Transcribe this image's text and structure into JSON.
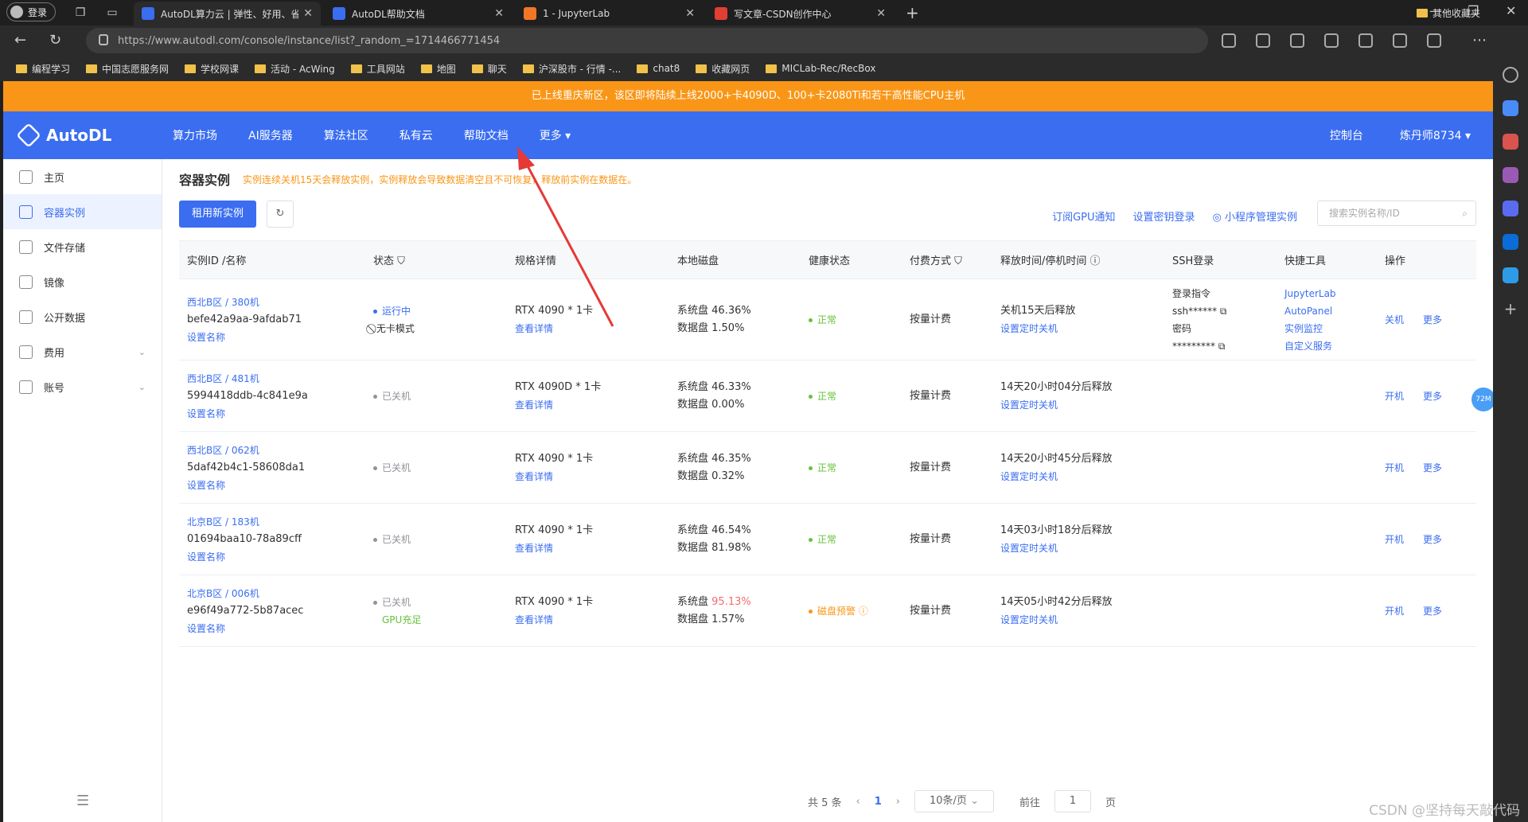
{
  "browser": {
    "profile_label": "登录",
    "tabs": [
      {
        "title": "AutoDL算力云 | 弹性、好用、省",
        "fav_color": "#3a6df0",
        "active": true
      },
      {
        "title": "AutoDL帮助文档",
        "fav_color": "#3a6df0",
        "active": false
      },
      {
        "title": "1 - JupyterLab",
        "fav_color": "#f37626",
        "active": false
      },
      {
        "title": "写文章-CSDN创作中心",
        "fav_color": "#e33e33",
        "active": false
      }
    ],
    "url": "https://www.autodl.com/console/instance/list?_random_=1714466771454",
    "bookmarks": [
      "编程学习",
      "中国志愿服务网",
      "学校网课",
      "活动 - AcWing",
      "工具网站",
      "地图",
      "聊天",
      "沪深股市 - 行情 -...",
      "chat8",
      "收藏网页",
      "MICLab-Rec/RecBox"
    ],
    "other_bookmarks": "其他收藏夹"
  },
  "banner": "已上线重庆新区，该区即将陆续上线2000+卡4090D、100+卡2080Ti和若干高性能CPU主机",
  "nav": {
    "logo": "AutoDL",
    "items": [
      "算力市场",
      "AI服务器",
      "算法社区",
      "私有云",
      "帮助文档",
      "更多 ▾"
    ],
    "console": "控制台",
    "user": "炼丹师8734 ▾"
  },
  "sidebar": {
    "items": [
      {
        "label": "主页",
        "active": false,
        "chev": ""
      },
      {
        "label": "容器实例",
        "active": true,
        "chev": ""
      },
      {
        "label": "文件存储",
        "active": false,
        "chev": ""
      },
      {
        "label": "镜像",
        "active": false,
        "chev": ""
      },
      {
        "label": "公开数据",
        "active": false,
        "chev": ""
      },
      {
        "label": "费用",
        "active": false,
        "chev": "⌄"
      },
      {
        "label": "账号",
        "active": false,
        "chev": "⌄"
      }
    ]
  },
  "main": {
    "title": "容器实例",
    "warning": "实例连续关机15天会释放实例，实例释放会导致数据清空且不可恢复，释放前实例在数据在。",
    "rent_button": "租用新实例",
    "top_links": [
      "订阅GPU通知",
      "设置密钥登录",
      "◎ 小程序管理实例"
    ],
    "search_placeholder": "搜索实例名称/ID",
    "columns": [
      "实例ID /名称",
      "状态 ⛉",
      "规格详情",
      "本地磁盘",
      "健康状态",
      "付费方式 ⛉",
      "释放时间/停机时间 ⓘ",
      "SSH登录",
      "快捷工具",
      "操作"
    ],
    "rows": [
      {
        "name": "西北B区 / 380机",
        "id": "befe42a9aa-9afdab71",
        "set_name": "设置名称",
        "status": "运行中",
        "status2": "⃠ 无卡模式",
        "status_color": "#3a6df0",
        "spec": "RTX 4090 * 1卡",
        "detail": "查看详情",
        "sys_label": "系统盘",
        "sys": "46.36%",
        "sys_warn": false,
        "data_disk": "数据盘 1.50%",
        "health": "正常",
        "health_color": "#67c23a",
        "pay": "按量计费",
        "release": "关机15天后释放",
        "timer": "设置定时关机",
        "ssh": [
          "登录指令",
          "ssh****** ⧉",
          "密码",
          "********* ⧉"
        ],
        "tools": [
          "JupyterLab",
          "AutoPanel",
          "实例监控",
          "自定义服务"
        ],
        "op1": "关机",
        "op2": "更多"
      },
      {
        "name": "西北B区 / 481机",
        "id": "5994418ddb-4c841e9a",
        "set_name": "设置名称",
        "status": "已关机",
        "status2": "",
        "status_color": "#909399",
        "spec": "RTX 4090D * 1卡",
        "detail": "查看详情",
        "sys_label": "系统盘",
        "sys": "46.33%",
        "sys_warn": false,
        "data_disk": "数据盘 0.00%",
        "health": "正常",
        "health_color": "#67c23a",
        "pay": "按量计费",
        "release": "14天20小时04分后释放",
        "timer": "设置定时关机",
        "ssh": [],
        "tools": [],
        "op1": "开机",
        "op2": "更多"
      },
      {
        "name": "西北B区 / 062机",
        "id": "5daf42b4c1-58608da1",
        "set_name": "设置名称",
        "status": "已关机",
        "status2": "",
        "status_color": "#909399",
        "spec": "RTX 4090 * 1卡",
        "detail": "查看详情",
        "sys_label": "系统盘",
        "sys": "46.35%",
        "sys_warn": false,
        "data_disk": "数据盘 0.32%",
        "health": "正常",
        "health_color": "#67c23a",
        "pay": "按量计费",
        "release": "14天20小时45分后释放",
        "timer": "设置定时关机",
        "ssh": [],
        "tools": [],
        "op1": "开机",
        "op2": "更多"
      },
      {
        "name": "北京B区 / 183机",
        "id": "01694baa10-78a89cff",
        "set_name": "设置名称",
        "status": "已关机",
        "status2": "",
        "status_color": "#909399",
        "spec": "RTX 4090 * 1卡",
        "detail": "查看详情",
        "sys_label": "系统盘",
        "sys": "46.54%",
        "sys_warn": false,
        "data_disk": "数据盘 81.98%",
        "health": "正常",
        "health_color": "#67c23a",
        "pay": "按量计费",
        "release": "14天03小时18分后释放",
        "timer": "设置定时关机",
        "ssh": [],
        "tools": [],
        "op1": "开机",
        "op2": "更多"
      },
      {
        "name": "北京B区 / 006机",
        "id": "e96f49a772-5b87acec",
        "set_name": "设置名称",
        "status": "已关机",
        "status2": "GPU充足",
        "status_color": "#909399",
        "spec": "RTX 4090 * 1卡",
        "detail": "查看详情",
        "sys_label": "系统盘",
        "sys": "95.13%",
        "sys_warn": true,
        "data_disk": "数据盘 1.57%",
        "health": "磁盘预警 ⓘ",
        "health_color": "#fa9617",
        "pay": "按量计费",
        "release": "14天05小时42分后释放",
        "timer": "设置定时关机",
        "ssh": [],
        "tools": [],
        "op1": "开机",
        "op2": "更多"
      }
    ],
    "pager": {
      "total": "共 5 条",
      "current": "1",
      "per_page": "10条/页",
      "goto": "前往",
      "goto_value": "1",
      "page_suffix": "页"
    }
  },
  "float_badge": "72M",
  "watermark": "CSDN @坚持每天敲代码",
  "colors": {
    "accent": "#3a6df0",
    "banner": "#fa9617",
    "annotation_arrow": "#e53935"
  }
}
